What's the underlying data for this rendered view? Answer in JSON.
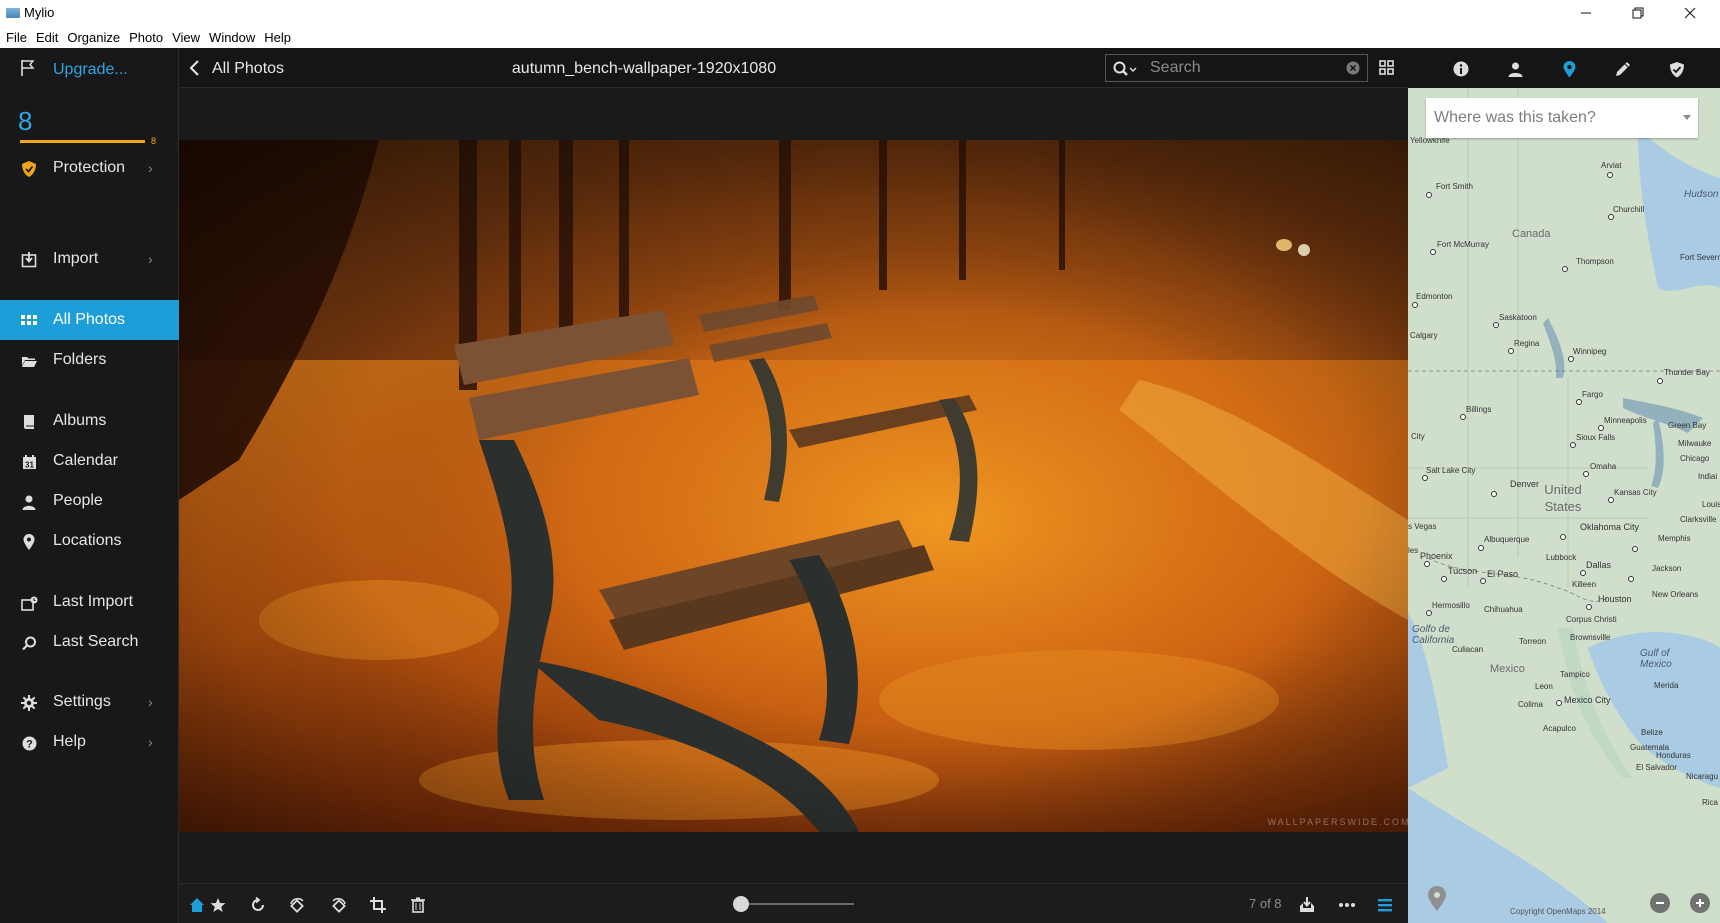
{
  "window": {
    "title": "Mylio",
    "controls": [
      "minimize",
      "restore",
      "close"
    ]
  },
  "menu": [
    "File",
    "Edit",
    "Organize",
    "Photo",
    "View",
    "Window",
    "Help"
  ],
  "sidebar": {
    "upgrade_label": "Upgrade...",
    "photo_count": "8",
    "bar_count": "8",
    "items": [
      {
        "label": "Protection",
        "icon": "shield-icon",
        "chevron": true
      },
      {
        "label": "Import",
        "icon": "import-icon",
        "chevron": true
      },
      {
        "label": "All Photos",
        "icon": "grid-icon",
        "chevron": false,
        "active": true
      },
      {
        "label": "Folders",
        "icon": "folder-icon",
        "chevron": false
      },
      {
        "label": "Albums",
        "icon": "album-icon",
        "chevron": false
      },
      {
        "label": "Calendar",
        "icon": "calendar-icon",
        "chevron": false
      },
      {
        "label": "People",
        "icon": "person-icon",
        "chevron": false
      },
      {
        "label": "Locations",
        "icon": "pin-icon",
        "chevron": false
      },
      {
        "label": "Last Import",
        "icon": "last-import-icon",
        "chevron": false
      },
      {
        "label": "Last Search",
        "icon": "search-icon",
        "chevron": false
      },
      {
        "label": "Settings",
        "icon": "gear-icon",
        "chevron": true
      },
      {
        "label": "Help",
        "icon": "help-icon",
        "chevron": true
      }
    ]
  },
  "header": {
    "back_label": "All Photos",
    "photo_title": "autumn_bench-wallpaper-1920x1080",
    "search_placeholder": "Search"
  },
  "photo": {
    "watermark": "WALLPAPERSWIDE.COM"
  },
  "bottom_toolbar": {
    "pager": "7 of 8",
    "zoom_level": 0.05
  },
  "right_panel": {
    "tabs": [
      "info-icon",
      "person-icon",
      "pin-icon",
      "pencil-icon",
      "shield-icon"
    ],
    "active_tab": "pin-icon",
    "location_placeholder": "Where was this taken?",
    "map_labels": {
      "yellowknife": "Yellowknife",
      "arviat": "Arviat",
      "fort_smith": "Fort Smith",
      "churchill": "Churchill",
      "hudson_bay": "Hudson Bay",
      "canada": "Canada",
      "fort_mcmurray": "Fort McMurray",
      "thompson": "Thompson",
      "fort_severn": "Fort Severn",
      "edmonton": "Edmonton",
      "saskatoon": "Saskatoon",
      "calgary": "Calgary",
      "regina": "Regina",
      "winnipeg": "Winnipeg",
      "thunder_bay": "Thunder Bay",
      "fargo": "Fargo",
      "billings": "Billings",
      "minneapolis": "Minneapolis",
      "green_bay": "Green Bay",
      "city": "City",
      "sioux_falls": "Sioux Falls",
      "milwaukee": "Milwauke",
      "chicago": "Chicago",
      "salt_lake_city": "Salt Lake City",
      "omaha": "Omaha",
      "indiana": "Indiai",
      "denver": "Denver",
      "united_states": "United States",
      "kansas_city": "Kansas City",
      "louisville": "Louis",
      "las_vegas": "s Vegas",
      "clarksville": "Clarksville",
      "albuquerque": "Albuquerque",
      "oklahoma_city": "Oklahoma City",
      "memphis": "Memphis",
      "les": "les",
      "phoenix": "Phoenix",
      "lubbock": "Lubbock",
      "dallas": "Dallas",
      "tucson": "Tucson",
      "el_paso": "El Paso",
      "jackson": "Jackson",
      "killeen": "Killeen",
      "houston": "Houston",
      "new_orleans": "New Orleans",
      "hermosillo": "Hermosillo",
      "chihuahua": "Chihuahua",
      "corpus_christi": "Corpus Christi",
      "golfo": "Golfo de California",
      "torreon": "Torreon",
      "brownsville": "Brownsville",
      "culiacan": "Culiacan",
      "gulf": "Gulf of Mexico",
      "mexico": "Mexico",
      "tampico": "Tampico",
      "leon": "Leon",
      "merida": "Merida",
      "mexico_city": "Mexico City",
      "colima": "Colima",
      "acapulco": "Acapulco",
      "belize": "Belize",
      "guatemala": "Guatemala",
      "honduras": "Honduras",
      "el_salvador": "El Salvador",
      "nicaragua": "Nicaragu",
      "rica": "Rica"
    },
    "copyright": "Copyright OpenMaps 2014"
  },
  "colors": {
    "accent": "#1e9ed8",
    "upgrade": "#2fa6e3",
    "progress": "#f2a71b"
  }
}
